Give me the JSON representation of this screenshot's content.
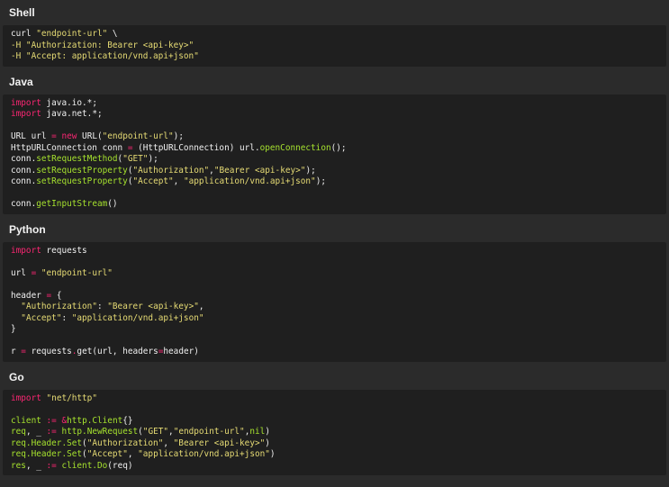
{
  "sections": [
    {
      "title": "Shell",
      "lines": [
        [
          {
            "type": "plain",
            "text": "curl "
          },
          {
            "type": "string",
            "text": "\"endpoint-url\""
          },
          {
            "type": "plain",
            "text": " \\"
          }
        ],
        [
          {
            "type": "string",
            "text": "-H \"Authorization: Bearer <api-key>\""
          }
        ],
        [
          {
            "type": "string",
            "text": "-H \"Accept: application/vnd.api+json\""
          }
        ]
      ]
    },
    {
      "title": "Java",
      "lines": [
        [
          {
            "type": "keyword",
            "text": "import"
          },
          {
            "type": "plain",
            "text": " java.io.*;"
          }
        ],
        [
          {
            "type": "keyword",
            "text": "import"
          },
          {
            "type": "plain",
            "text": " java.net.*;"
          }
        ],
        [],
        [
          {
            "type": "plain",
            "text": "URL url "
          },
          {
            "type": "op",
            "text": "="
          },
          {
            "type": "plain",
            "text": " "
          },
          {
            "type": "keyword",
            "text": "new"
          },
          {
            "type": "plain",
            "text": " URL("
          },
          {
            "type": "string",
            "text": "\"endpoint-url\""
          },
          {
            "type": "plain",
            "text": ");"
          }
        ],
        [
          {
            "type": "plain",
            "text": "HttpURLConnection conn "
          },
          {
            "type": "op",
            "text": "="
          },
          {
            "type": "plain",
            "text": " (HttpURLConnection) url."
          },
          {
            "type": "method",
            "text": "openConnection"
          },
          {
            "type": "plain",
            "text": "();"
          }
        ],
        [
          {
            "type": "plain",
            "text": "conn."
          },
          {
            "type": "method",
            "text": "setRequestMethod"
          },
          {
            "type": "plain",
            "text": "("
          },
          {
            "type": "string",
            "text": "\"GET\""
          },
          {
            "type": "plain",
            "text": ");"
          }
        ],
        [
          {
            "type": "plain",
            "text": "conn."
          },
          {
            "type": "method",
            "text": "setRequestProperty"
          },
          {
            "type": "plain",
            "text": "("
          },
          {
            "type": "string",
            "text": "\"Authorization\""
          },
          {
            "type": "plain",
            "text": ","
          },
          {
            "type": "string",
            "text": "\"Bearer <api-key>\""
          },
          {
            "type": "plain",
            "text": ");"
          }
        ],
        [
          {
            "type": "plain",
            "text": "conn."
          },
          {
            "type": "method",
            "text": "setRequestProperty"
          },
          {
            "type": "plain",
            "text": "("
          },
          {
            "type": "string",
            "text": "\"Accept\""
          },
          {
            "type": "plain",
            "text": ", "
          },
          {
            "type": "string",
            "text": "\"application/vnd.api+json\""
          },
          {
            "type": "plain",
            "text": ");"
          }
        ],
        [],
        [
          {
            "type": "plain",
            "text": "conn."
          },
          {
            "type": "method",
            "text": "getInputStream"
          },
          {
            "type": "plain",
            "text": "()"
          }
        ]
      ]
    },
    {
      "title": "Python",
      "lines": [
        [
          {
            "type": "keyword",
            "text": "import"
          },
          {
            "type": "plain",
            "text": " requests"
          }
        ],
        [],
        [
          {
            "type": "plain",
            "text": "url "
          },
          {
            "type": "op",
            "text": "="
          },
          {
            "type": "plain",
            "text": " "
          },
          {
            "type": "string",
            "text": "\"endpoint-url\""
          }
        ],
        [],
        [
          {
            "type": "plain",
            "text": "header "
          },
          {
            "type": "op",
            "text": "="
          },
          {
            "type": "plain",
            "text": " {"
          }
        ],
        [
          {
            "type": "plain",
            "text": "  "
          },
          {
            "type": "string",
            "text": "\"Authorization\""
          },
          {
            "type": "plain",
            "text": ": "
          },
          {
            "type": "string",
            "text": "\"Bearer <api-key>\""
          },
          {
            "type": "plain",
            "text": ","
          }
        ],
        [
          {
            "type": "plain",
            "text": "  "
          },
          {
            "type": "string",
            "text": "\"Accept\""
          },
          {
            "type": "plain",
            "text": ": "
          },
          {
            "type": "string",
            "text": "\"application/vnd.api+json\""
          }
        ],
        [
          {
            "type": "plain",
            "text": "}"
          }
        ],
        [],
        [
          {
            "type": "plain",
            "text": "r "
          },
          {
            "type": "op",
            "text": "="
          },
          {
            "type": "plain",
            "text": " requests"
          },
          {
            "type": "op",
            "text": "."
          },
          {
            "type": "plain",
            "text": "get(url, headers"
          },
          {
            "type": "op",
            "text": "="
          },
          {
            "type": "plain",
            "text": "header)"
          }
        ]
      ]
    },
    {
      "title": "Go",
      "lines": [
        [
          {
            "type": "keyword",
            "text": "import"
          },
          {
            "type": "plain",
            "text": " "
          },
          {
            "type": "string",
            "text": "\"net/http\""
          }
        ],
        [],
        [
          {
            "type": "method",
            "text": "client"
          },
          {
            "type": "plain",
            "text": " "
          },
          {
            "type": "op",
            "text": ":="
          },
          {
            "type": "plain",
            "text": " "
          },
          {
            "type": "op",
            "text": "&"
          },
          {
            "type": "method",
            "text": "http.Client"
          },
          {
            "type": "plain",
            "text": "{}"
          }
        ],
        [
          {
            "type": "method",
            "text": "req"
          },
          {
            "type": "plain",
            "text": ", _ "
          },
          {
            "type": "op",
            "text": ":="
          },
          {
            "type": "plain",
            "text": " "
          },
          {
            "type": "method",
            "text": "http.NewRequest"
          },
          {
            "type": "plain",
            "text": "("
          },
          {
            "type": "string",
            "text": "\"GET\""
          },
          {
            "type": "plain",
            "text": ","
          },
          {
            "type": "string",
            "text": "\"endpoint-url\""
          },
          {
            "type": "plain",
            "text": ","
          },
          {
            "type": "method",
            "text": "nil"
          },
          {
            "type": "plain",
            "text": ")"
          }
        ],
        [
          {
            "type": "method",
            "text": "req.Header.Set"
          },
          {
            "type": "plain",
            "text": "("
          },
          {
            "type": "string",
            "text": "\"Authorization\""
          },
          {
            "type": "plain",
            "text": ", "
          },
          {
            "type": "string",
            "text": "\"Bearer <api-key>\""
          },
          {
            "type": "plain",
            "text": ")"
          }
        ],
        [
          {
            "type": "method",
            "text": "req.Header.Set"
          },
          {
            "type": "plain",
            "text": "("
          },
          {
            "type": "string",
            "text": "\"Accept\""
          },
          {
            "type": "plain",
            "text": ", "
          },
          {
            "type": "string",
            "text": "\"application/vnd.api+json\""
          },
          {
            "type": "plain",
            "text": ")"
          }
        ],
        [
          {
            "type": "method",
            "text": "res"
          },
          {
            "type": "plain",
            "text": ", _ "
          },
          {
            "type": "op",
            "text": ":="
          },
          {
            "type": "plain",
            "text": " "
          },
          {
            "type": "method",
            "text": "client.Do"
          },
          {
            "type": "plain",
            "text": "(req)"
          }
        ]
      ]
    }
  ],
  "colors": {
    "background": "#2b2b2b",
    "code_background": "#1f1f1f",
    "string": "#e6db74",
    "keyword": "#f92672",
    "method": "#a6e22e",
    "plain": "#f0f0f0"
  }
}
